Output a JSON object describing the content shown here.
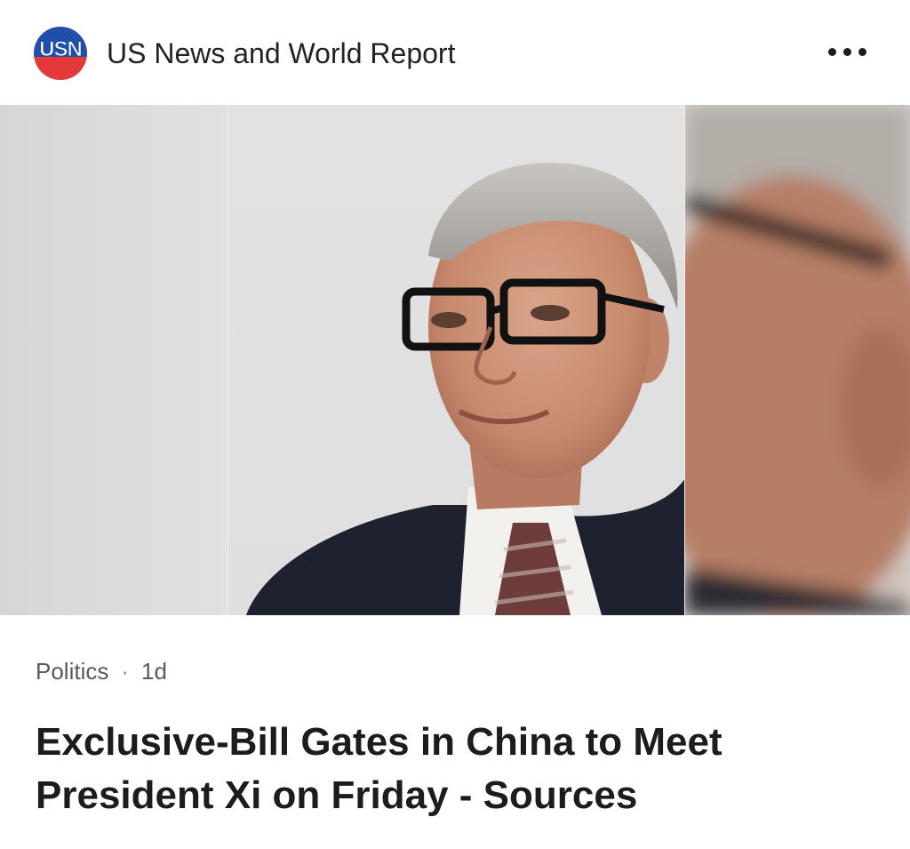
{
  "header": {
    "logo_text": "USN",
    "publisher": "US News and World Report",
    "more_icon": "more-horizontal-icon"
  },
  "hero": {
    "image_subject": "photo"
  },
  "article": {
    "category": "Politics",
    "separator": "·",
    "age": "1d",
    "headline": "Exclusive-Bill Gates in China to Meet President Xi on Friday - Sources"
  },
  "colors": {
    "logo_blue": "#1f4fa8",
    "logo_red": "#e23a3a",
    "text_primary": "#1c1c1e",
    "text_secondary": "#5a5a5e"
  }
}
